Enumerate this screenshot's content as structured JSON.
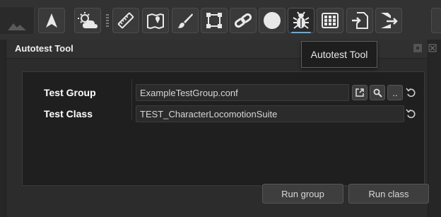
{
  "toolbar": {
    "buttons": [
      {
        "icon": "navigation-arrow-icon"
      },
      {
        "icon": "weather-sun-cloud-icon"
      },
      {
        "icon": "ruler-icon"
      },
      {
        "icon": "map-icon"
      },
      {
        "icon": "paint-brush-icon"
      },
      {
        "icon": "bounding-square-icon"
      },
      {
        "icon": "link-chain-icon"
      },
      {
        "icon": "circle-icon"
      },
      {
        "icon": "bug-icon"
      },
      {
        "icon": "grid-icon"
      },
      {
        "icon": "import-icon"
      },
      {
        "icon": "export-icon"
      }
    ],
    "active": "bug-icon"
  },
  "panel": {
    "title": "Autotest Tool",
    "test_group": {
      "label": "Test Group",
      "value": "ExampleTestGroup.conf",
      "browse_label": ".."
    },
    "test_class": {
      "label": "Test Class",
      "value": "TEST_CharacterLocomotionSuite"
    },
    "run_group_label": "Run group",
    "run_class_label": "Run class"
  },
  "tooltip": {
    "text": "Autotest Tool"
  },
  "colors": {
    "background": "#2d2d2d",
    "accent": "#5ab0e8",
    "field": "#2b2b2b"
  }
}
